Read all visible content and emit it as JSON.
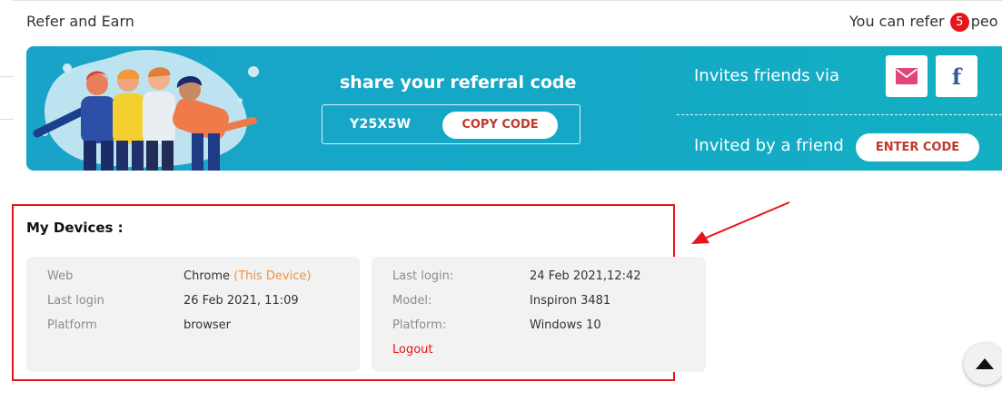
{
  "header": {
    "title": "Refer and Earn",
    "refer_prefix": "You can refer",
    "refer_count": "5",
    "refer_suffix": "peo"
  },
  "banner": {
    "share_heading": "share your referral code",
    "referral_code": "Y25X5W",
    "copy_label": "COPY CODE",
    "invite_via_label": "Invites friends via",
    "invited_by_label": "Invited by a friend",
    "enter_code_label": "ENTER CODE",
    "social": [
      {
        "icon": "mail-icon",
        "color": "#e0457b"
      },
      {
        "icon": "facebook-icon",
        "glyph": "f",
        "color": "#3b5998"
      }
    ]
  },
  "devices": {
    "title": "My Devices :",
    "cards": [
      {
        "rows": [
          {
            "label": "Web",
            "value": "Chrome",
            "tag": "(This Device)"
          },
          {
            "label": "Last login",
            "value": "26 Feb 2021, 11:09"
          },
          {
            "label": "Platform",
            "value": "browser"
          }
        ]
      },
      {
        "rows": [
          {
            "label": "Last login:",
            "value": "24 Feb 2021,12:42"
          },
          {
            "label": "Model:",
            "value": "Inspiron 3481"
          },
          {
            "label": "Platform:",
            "value": "Windows 10"
          }
        ],
        "logout_label": "Logout"
      }
    ]
  },
  "colors": {
    "accent_red": "#e8141b",
    "banner_blue": "#14a8c6",
    "device_tag_orange": "#f0923e"
  }
}
